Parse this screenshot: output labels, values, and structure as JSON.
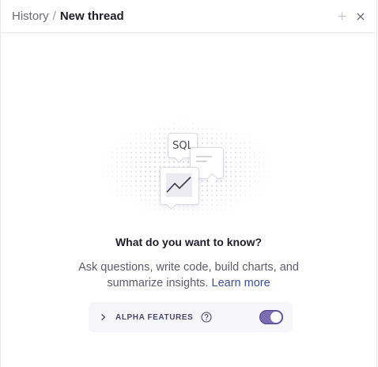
{
  "header": {
    "breadcrumb_root": "History",
    "breadcrumb_separator": "/",
    "breadcrumb_current": "New thread",
    "add_icon": "plus-icon",
    "close_icon": "close-icon"
  },
  "illustration": {
    "sql_label": "SQL"
  },
  "prompt": {
    "title": "What do you want to know?",
    "subtitle": "Ask questions, write code, build charts, and summarize insights.",
    "learn_more": "Learn more"
  },
  "alpha": {
    "label": "ALPHA FEATURES",
    "toggle_on": true,
    "accent": "#7a6bb3"
  }
}
